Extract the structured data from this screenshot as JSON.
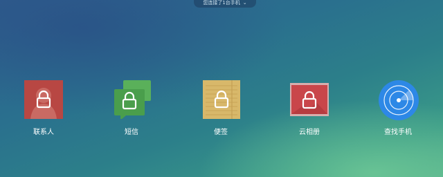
{
  "header": {
    "device_status": "您连接了1台手机"
  },
  "apps": [
    {
      "label": "联系人",
      "icon": "contacts-lock-icon",
      "color": "#b84743"
    },
    {
      "label": "短信",
      "icon": "sms-lock-icon",
      "color": "#4a9e4c"
    },
    {
      "label": "便签",
      "icon": "notes-lock-icon",
      "color": "#d8b86a"
    },
    {
      "label": "云相册",
      "icon": "album-lock-icon",
      "color": "#c9464a"
    },
    {
      "label": "查找手机",
      "icon": "find-phone-radar-icon",
      "color": "#2d88e6"
    }
  ]
}
